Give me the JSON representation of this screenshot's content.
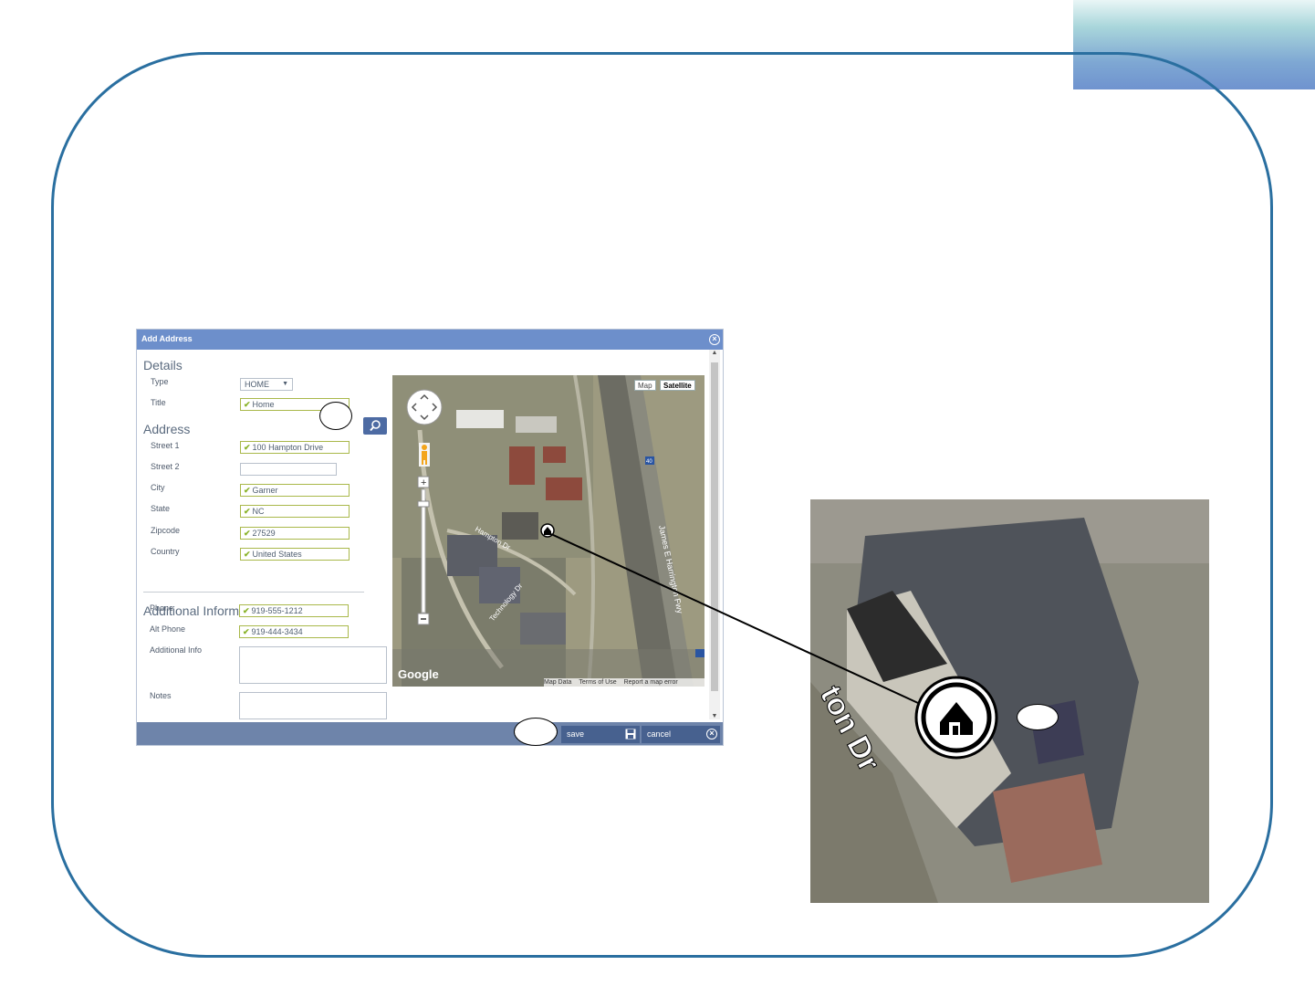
{
  "dialog": {
    "title": "Add Address",
    "sections": {
      "details": "Details",
      "address": "Address",
      "additional": "Additional Information"
    },
    "fields": {
      "type": {
        "label": "Type",
        "value": "HOME"
      },
      "title": {
        "label": "Title",
        "value": "Home"
      },
      "street1": {
        "label": "Street 1",
        "value": "100 Hampton Drive"
      },
      "street2": {
        "label": "Street 2",
        "value": ""
      },
      "city": {
        "label": "City",
        "value": "Garner"
      },
      "state": {
        "label": "State",
        "value": "NC"
      },
      "zipcode": {
        "label": "Zipcode",
        "value": "27529"
      },
      "country": {
        "label": "Country",
        "value": "United States"
      },
      "phone": {
        "label": "Phone",
        "value": "919-555-1212"
      },
      "alt_phone": {
        "label": "Alt Phone",
        "value": "919-444-3434"
      },
      "additional_info": {
        "label": "Additional Info"
      },
      "notes": {
        "label": "Notes"
      }
    },
    "footer": {
      "save_label": "save",
      "cancel_label": "cancel"
    }
  },
  "map": {
    "type_buttons": {
      "map": "Map",
      "satellite": "Satellite"
    },
    "logo": "Google",
    "footer": {
      "map_data": "Map Data",
      "terms": "Terms of Use",
      "report": "Report a map error"
    },
    "road_labels": {
      "hampton": "Hampton Dr",
      "technology": "Technology Dr",
      "highway": "James E Harrington Fwy",
      "interstate": "40",
      "zoom_road": "ton Dr"
    }
  },
  "colors": {
    "frame": "#2a6fa0",
    "header": "#6d8fcb",
    "footer": "#6e84aa",
    "check": "#8ab32a"
  }
}
